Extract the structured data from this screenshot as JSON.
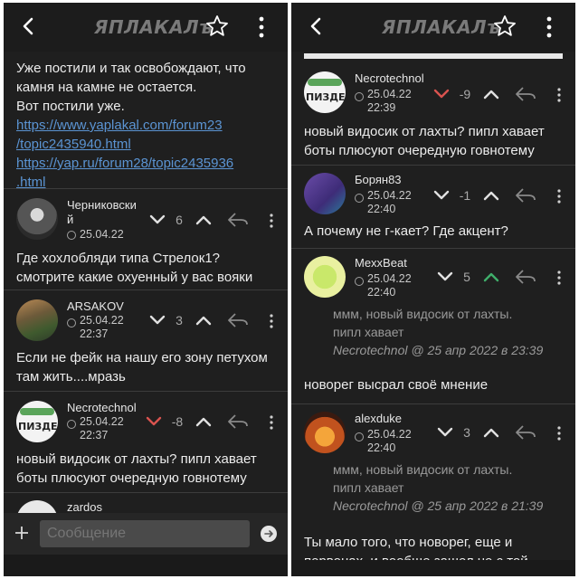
{
  "app": {
    "logo": "ЯПЛАКАЛъ"
  },
  "left": {
    "top_post": {
      "lines": [
        "Уже постили и так освобождают, что",
        "камня на камне не остается.",
        "Вот постили уже."
      ],
      "links": [
        "https://www.yaplakal.com/forum23",
        "/topic2435940.html",
        "https://yap.ru/forum28/topic2435936",
        ".html"
      ]
    },
    "posts": [
      {
        "user_line1": "Черниковски",
        "user_line2": "й",
        "date": "25.04.22",
        "score": "6",
        "text": [
          "Где хохлобляди типа Стрелок1?",
          "смотрите какие охуенный у вас вояки"
        ]
      },
      {
        "user": "ARSAKOV",
        "date": "25.04.22",
        "time": "22:37",
        "score": "3",
        "text": [
          "Если не фейк на нашу его зону петухом",
          "там жить....мразь"
        ]
      },
      {
        "user": "Necrotechnol",
        "date": "25.04.22",
        "time": "22:37",
        "score": "-8",
        "text": [
          "новый видосик от лахты? пипл хавает",
          "боты плюсуют очередную говнотему"
        ]
      },
      {
        "user": "zardos"
      }
    ],
    "composer": {
      "placeholder": "Сообщение"
    }
  },
  "right": {
    "posts": [
      {
        "user": "Necrotechnol",
        "date": "25.04.22",
        "time": "22:39",
        "score": "-9",
        "text": [
          "новый видосик от лахты? пипл хавает",
          "боты плюсуют очередную говнотему"
        ]
      },
      {
        "user": "Борян83",
        "date": "25.04.22",
        "time": "22:40",
        "score": "-1",
        "text": [
          "А почему не г-кает? Где акцент?"
        ]
      },
      {
        "user": "MexxBeat",
        "date": "25.04.22",
        "time": "22:40",
        "score": "5",
        "quote": [
          "ммм, новый видосик от лахты.",
          "пипл хавает"
        ],
        "quote_src_user": "Necrotechnol",
        "quote_src_rest": " @ 25 апр 2022 в 23:39",
        "text": [
          "новорег высрал своё мнение"
        ]
      },
      {
        "user": "alexduke",
        "date": "25.04.22",
        "time": "22:40",
        "score": "3",
        "quote": [
          "ммм, новый видосик от лахты.",
          "пипл хавает"
        ],
        "quote_src_user": "Necrotechnol",
        "quote_src_rest": " @ 25 апр 2022 в 21:39",
        "text": [
          "Ты мало того, что новорег, еще и",
          "первонах, и вообще зашел не с той"
        ]
      }
    ]
  },
  "colors": {
    "background": "#1f1f1f",
    "link": "#5b94d3",
    "downvote_active": "#d9534f",
    "upvote_active": "#3fae6a",
    "text": "#ececec",
    "muted": "#9a9a9a"
  },
  "icons": [
    "back-arrow-icon",
    "star-icon",
    "kebab-menu-icon",
    "clock-icon",
    "chevron-down-icon",
    "chevron-up-icon",
    "reply-arrow-icon",
    "plus-icon",
    "send-icon"
  ]
}
